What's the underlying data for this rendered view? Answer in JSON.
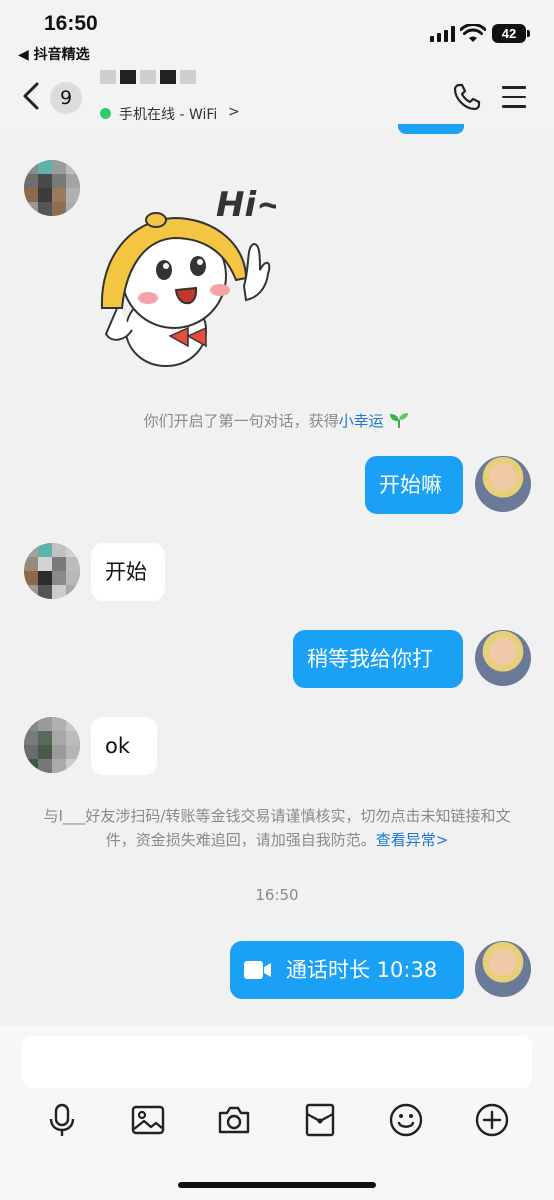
{
  "status_bar": {
    "time": "16:50",
    "back_app": "◀ 抖音精选",
    "battery": "42"
  },
  "header": {
    "unread_count": "9",
    "online_status": "手机在线 - WiFi",
    "online_arrow": ">"
  },
  "messages": {
    "system_intro_prefix": "你们开启了第一句对话，获得",
    "system_intro_link": "小幸运",
    "out_1": "开始嘛",
    "in_1": "开始",
    "out_2": "稍等我给你打",
    "in_2": "ok",
    "warning_text": "与I___好友涉扫码/转账等金钱交易请谨慎核实，切勿点击未知链接和文件，资金损失难追回，请加强自我防范。",
    "warning_link": "查看异常>",
    "timestamp": "16:50",
    "call_label": "通话时长 10:38"
  },
  "sticker": {
    "text": "Hi~"
  },
  "input": {
    "placeholder": ""
  },
  "colors": {
    "accent_blue": "#1aa0f5",
    "link_blue": "#1b77d8",
    "online_green": "#2ecc71",
    "system_gray": "#8a8a8a"
  },
  "icons": {
    "toolbar": [
      "microphone-icon",
      "image-icon",
      "camera-icon",
      "red-packet-icon",
      "emoji-icon",
      "plus-icon"
    ]
  }
}
